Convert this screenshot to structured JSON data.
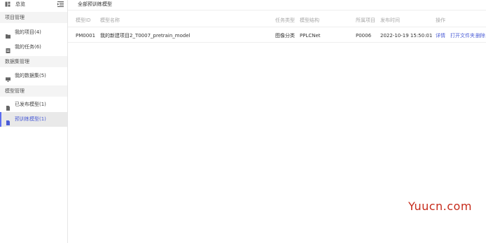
{
  "sidebar": {
    "home_label": "总览",
    "groups": [
      {
        "label": "项目管理"
      },
      {
        "label": "数据集管理"
      },
      {
        "label": "模型管理"
      }
    ],
    "items": [
      {
        "label": "我的项目(4)",
        "icon": "folder-icon"
      },
      {
        "label": "我的任务(6)",
        "icon": "task-icon"
      },
      {
        "label": "我的数据集(5)",
        "icon": "monitor-icon"
      },
      {
        "label": "已发布模型(1)",
        "icon": "file-icon"
      },
      {
        "label": "预训练模型(1)",
        "icon": "file-icon",
        "active": true
      }
    ]
  },
  "main": {
    "tab_label": "全部预训练模型",
    "columns": [
      "模型ID",
      "模型名称",
      "任务类型",
      "模型结构",
      "所属项目",
      "发布时间",
      "操作"
    ],
    "rows": [
      {
        "id": "PM0001",
        "name": "我的新建项目2_T0007_pretrain_model",
        "task_type": "图像分类",
        "structure": "PPLCNet",
        "project": "P0006",
        "published": "2022-10-19 15:50:01",
        "actions": [
          "详情",
          "打开文件夹",
          "删除"
        ]
      }
    ]
  },
  "watermark": "Yuucn.com",
  "colors": {
    "accent": "#4a5cd6",
    "watermark": "#c62a1a"
  }
}
